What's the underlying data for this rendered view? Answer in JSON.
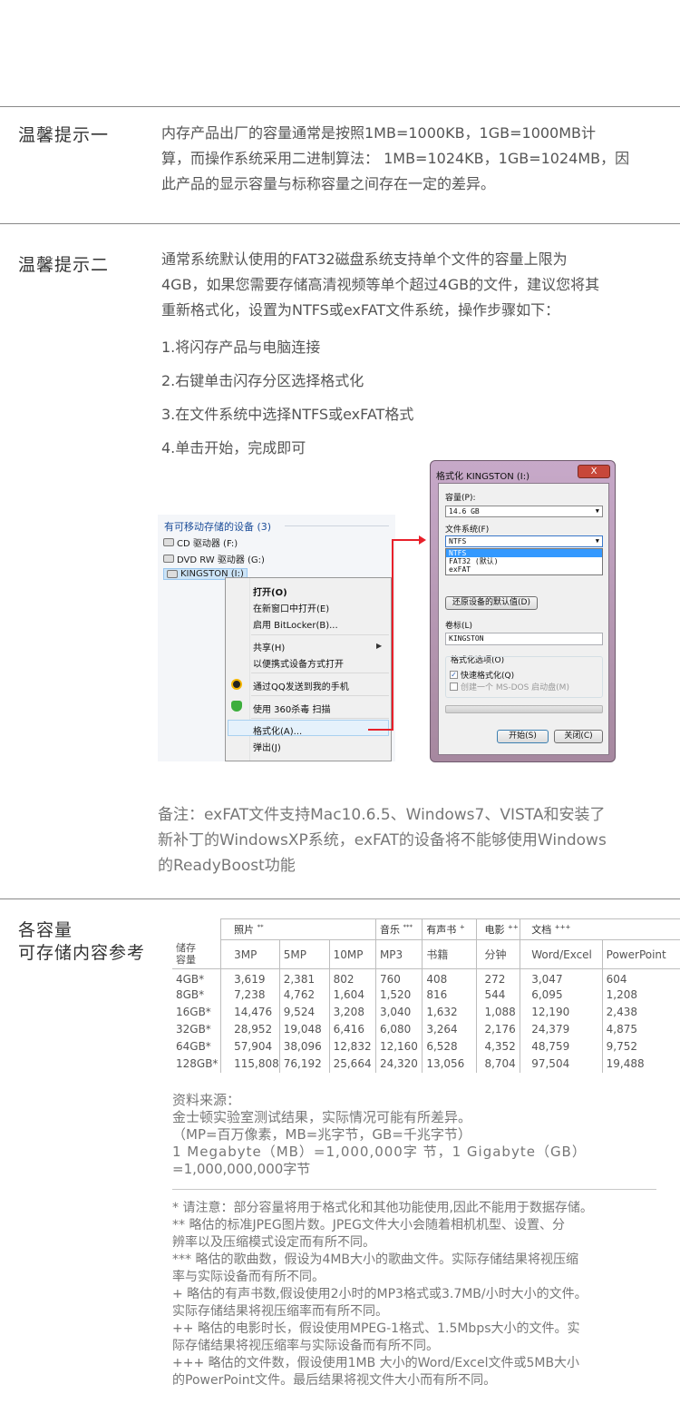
{
  "tip1": {
    "title": "温馨提示一",
    "lines": [
      "内存产品出厂的容量通常是按照1MB=1000KB，1GB=1000MB计",
      "算，而操作系统采用二进制算法： 1MB=1024KB，1GB=1024MB，因",
      "此产品的显示容量与标称容量之间存在一定的差异。"
    ]
  },
  "tip2": {
    "title": "温馨提示二",
    "lines": [
      "通常系统默认使用的FAT32磁盘系统支持单个文件的容量上限为",
      "4GB，如果您需要存储高清视频等单个超过4GB的文件，建议您将其",
      "重新格式化，设置为NTFS或exFAT文件系统，操作步骤如下："
    ],
    "steps": [
      "1.将闪存产品与电脑连接",
      "2.右键单击闪存分区选择格式化",
      "3.在文件系统中选择NTFS或exFAT格式",
      "4.单击开始，完成即可"
    ]
  },
  "explorer": {
    "heading": "有可移动存储的设备 (3)",
    "drives": [
      "CD 驱动器 (F:)",
      "DVD RW 驱动器 (G:)",
      "KINGSTON (I:)"
    ]
  },
  "context_menu": {
    "items": [
      "打开(O)",
      "在新窗口中打开(E)",
      "启用 BitLocker(B)...",
      "共享(H)",
      "以便携式设备方式打开",
      "通过QQ发送到我的手机",
      "使用 360杀毒 扫描",
      "格式化(A)...",
      "弹出(J)"
    ]
  },
  "format_dialog": {
    "title": "格式化 KINGSTON (I:)",
    "close": "X",
    "capacity_label": "容量(P):",
    "capacity_value": "14.6 GB",
    "fs_label": "文件系统(F)",
    "fs_value": "NTFS",
    "fs_options": [
      "NTFS",
      "FAT32 (默认)",
      "exFAT"
    ],
    "restore_button": "还原设备的默认值(D)",
    "volume_label": "卷标(L)",
    "volume_value": "KINGSTON",
    "options_label": "格式化选项(O)",
    "quick_format": "快速格式化(Q)",
    "msdos_disk": "创建一个 MS-DOS 启动盘(M)",
    "start_button": "开始(S)",
    "close_button": "关闭(C)"
  },
  "note": {
    "lines": [
      "备注：exFAT文件支持Mac10.6.5、Windows7、VISTA和安装了",
      "新补丁的WindowsXP系统，exFAT的设备将不能够使用Windows",
      "的ReadyBoost功能"
    ]
  },
  "capacity": {
    "title_line1": "各容量",
    "title_line2": "可存储内容参考",
    "groups": {
      "photo": "照片",
      "photo_mark": "**",
      "music": "音乐",
      "music_mark": "***",
      "audiobook": "有声书",
      "audiobook_mark": "+",
      "video": "电影",
      "video_mark": "++",
      "docs": "文档",
      "docs_mark": "+++"
    },
    "row_header_line1": "储存",
    "row_header_line2": "容量",
    "subheaders": [
      "3MP",
      "5MP",
      "10MP",
      "MP3",
      "书籍",
      "分钟",
      "Word/Excel",
      "PowerPoint"
    ],
    "rows": [
      [
        "4GB*",
        "3,619",
        "2,381",
        "802",
        "760",
        "408",
        "272",
        "3,047",
        "604"
      ],
      [
        "8GB*",
        "7,238",
        "4,762",
        "1,604",
        "1,520",
        "816",
        "544",
        "6,095",
        "1,208"
      ],
      [
        "16GB*",
        "14,476",
        "9,524",
        "3,208",
        "3,040",
        "1,632",
        "1,088",
        "12,190",
        "2,438"
      ],
      [
        "32GB*",
        "28,952",
        "19,048",
        "6,416",
        "6,080",
        "3,264",
        "2,176",
        "24,379",
        "4,875"
      ],
      [
        "64GB*",
        "57,904",
        "38,096",
        "12,832",
        "12,160",
        "6,528",
        "4,352",
        "48,759",
        "9,752"
      ],
      [
        "128GB*",
        "115,808",
        "76,192",
        "25,664",
        "24,320",
        "13,056",
        "8,704",
        "97,504",
        "19,488"
      ]
    ]
  },
  "source": {
    "lines": [
      "资料来源：",
      "金士顿实验室测试结果，实际情况可能有所差异。",
      "（MP=百万像素，MB=兆字节，GB=千兆字节）",
      "1 Megabyte（MB）=1,000,000字 节，1 Gigabyte（GB）",
      "=1,000,000,000字节"
    ]
  },
  "footnotes": {
    "lines": [
      "* 请注意：部分容量将用于格式化和其他功能使用,因此不能用于数据存储。",
      "** 略估的标准JPEG图片数。JPEG文件大小会随着相机机型、设置、分",
      "辨率以及压缩模式设定而有所不同。",
      "*** 略估的歌曲数，假设为4MB大小的歌曲文件。实际存储结果将视压缩",
      "率与实际设备而有所不同。",
      "+ 略估的有声书数,假设使用2小时的MP3格式或3.7MB/小时大小的文件。",
      "实际存储结果将视压缩率而有所不同。",
      "++ 略估的电影时长，假设使用MPEG-1格式、1.5Mbps大小的文件。实",
      "际存储结果将视压缩率与实际设备而有所不同。",
      "+++ 略估的文件数，假设使用1MB 大小的Word/Excel文件或5MB大小",
      "的PowerPoint文件。最后结果将视文件大小而有所不同。"
    ]
  }
}
